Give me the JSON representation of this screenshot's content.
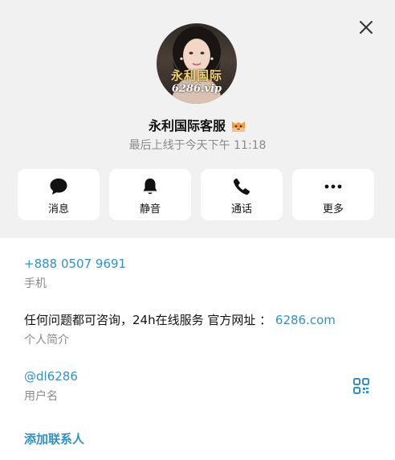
{
  "profile": {
    "avatar_line1": "永利国际",
    "avatar_line2": "6286.vip",
    "name": "永利国际客服",
    "name_emoji_icon": "cat-face-emoji-icon",
    "last_seen": "最后上线于今天下午 11:18"
  },
  "actions": [
    {
      "label": "消息",
      "icon": "message-icon"
    },
    {
      "label": "静音",
      "icon": "bell-icon"
    },
    {
      "label": "通话",
      "icon": "phone-icon"
    },
    {
      "label": "更多",
      "icon": "more-icon"
    }
  ],
  "info": {
    "phone": "+888 0507 9691",
    "phone_caption": "手机",
    "bio_text": "任何问题都可咨询，24h在线服务 官方网址 ：",
    "bio_link": "6286.com",
    "bio_caption": "个人简介",
    "username": "@dl6286",
    "username_caption": "用户名",
    "add_contact": "添加联系人"
  },
  "colors": {
    "accent": "#3390c6",
    "header_bg": "#f1f1f1",
    "caption": "#8a8a8a"
  }
}
